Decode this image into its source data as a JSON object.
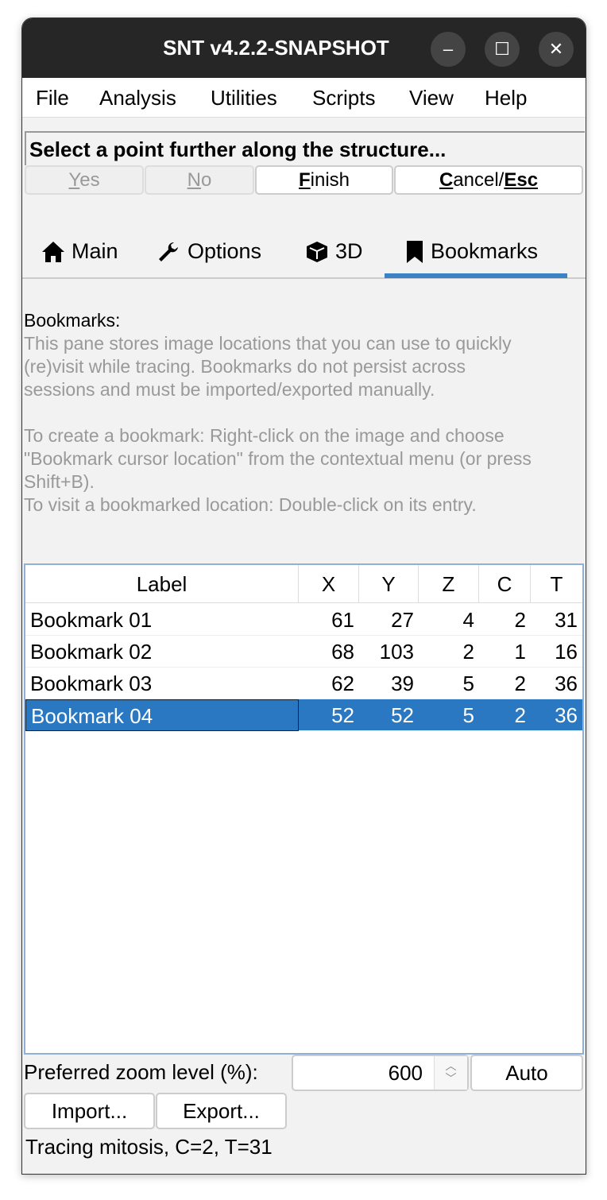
{
  "window": {
    "title": "SNT v4.2.2-SNAPSHOT"
  },
  "menu": [
    "File",
    "Analysis",
    "Utilities",
    "Scripts",
    "View",
    "Help"
  ],
  "status_message": "Select a point further along the structure...",
  "buttons": {
    "yes": {
      "m": "Y",
      "rest": "es",
      "enabled": false
    },
    "no": {
      "m": "N",
      "rest": "o",
      "enabled": false
    },
    "finish": {
      "m": "F",
      "rest": "inish",
      "enabled": true
    },
    "cancel": {
      "m": "C",
      "rest": "ancel/",
      "esc": "Esc",
      "enabled": true
    }
  },
  "tabs": [
    {
      "label": "Main",
      "icon": "home-icon"
    },
    {
      "label": "Options",
      "icon": "wrench-icon"
    },
    {
      "label": "3D",
      "icon": "cube-icon"
    },
    {
      "label": "Bookmarks",
      "icon": "bookmark-icon",
      "selected": true
    }
  ],
  "bookmarks_pane": {
    "heading": "Bookmarks:",
    "lines": [
      "This pane stores image locations that you can use to quickly",
      "(re)visit while tracing. Bookmarks do not persist across",
      "sessions and must be imported/exported manually.",
      "",
      "To create a bookmark: Right-click on the image and choose",
      "\"Bookmark cursor location\" from the contextual menu (or press",
      "Shift+B).",
      "To visit a bookmarked location: Double-click on its entry."
    ],
    "columns": [
      "Label",
      "X",
      "Y",
      "Z",
      "C",
      "T"
    ],
    "rows": [
      [
        "Bookmark 01",
        "61",
        "27",
        "4",
        "2",
        "31"
      ],
      [
        "Bookmark 02",
        "68",
        "103",
        "2",
        "1",
        "16"
      ],
      [
        "Bookmark 03",
        "62",
        "39",
        "5",
        "2",
        "36"
      ],
      [
        "Bookmark 04",
        "52",
        "52",
        "5",
        "2",
        "36"
      ]
    ],
    "selected_row": 3,
    "zoom_label": "Preferred zoom level (%):",
    "zoom_value": "600",
    "auto_label": "Auto",
    "import_label": "Import...",
    "export_label": "Export...",
    "footer_status": "Tracing mitosis, C=2, T=31"
  },
  "colors": {
    "accent": "#3a82c4",
    "selection": "#2a78c2",
    "titlebar": "#262626"
  }
}
